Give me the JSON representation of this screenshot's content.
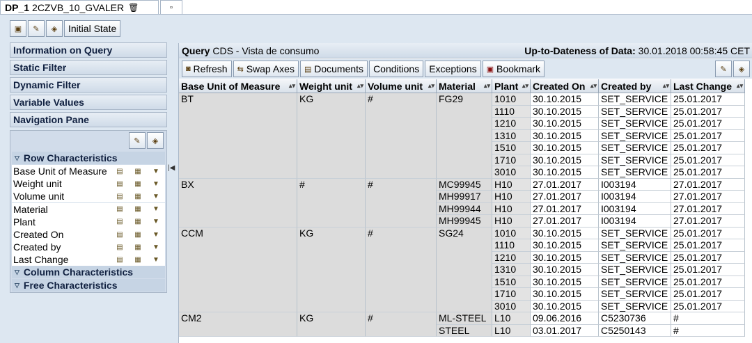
{
  "tab": {
    "id": "DP_1",
    "name": "2CZVB_10_GVALER",
    "delete_icon": "trash-icon",
    "new_icon": "new-page-icon"
  },
  "toolbar": {
    "initial_state": "Initial State",
    "icons": [
      "export-icon",
      "settings-icon",
      "bookmark-icon"
    ]
  },
  "left": {
    "headers": [
      "Information on Query",
      "Static Filter",
      "Dynamic Filter",
      "Variable Values",
      "Navigation Pane"
    ],
    "row_section": "Row Characteristics",
    "row_items": [
      "Base Unit of Measure",
      "Weight unit",
      "Volume unit",
      "Material",
      "Plant",
      "Created On",
      "Created by",
      "Last Change"
    ],
    "column_section": "Column Characteristics",
    "free_section": "Free Characteristics"
  },
  "query": {
    "label": "Query",
    "name": "CDS - Vista de consumo",
    "date_label": "Up-to-Dateness of Data:",
    "date_value": "30.01.2018 00:58:45 CET"
  },
  "rtoolbar": {
    "refresh": "Refresh",
    "swap": "Swap Axes",
    "documents": "Documents",
    "conditions": "Conditions",
    "exceptions": "Exceptions",
    "bookmark": "Bookmark"
  },
  "table": {
    "columns": [
      "Base Unit of Measure",
      "Weight unit",
      "Volume unit",
      "Material",
      "Plant",
      "Created On",
      "Created by",
      "Last Change"
    ],
    "groups": [
      {
        "uom": "BT",
        "weight": "KG",
        "volume": "#",
        "rows": [
          {
            "material": "FG29",
            "plant": "1010",
            "created_on": "30.10.2015",
            "created_by": "SET_SERVICE",
            "last_change": "25.01.2017"
          },
          {
            "material": "",
            "plant": "1110",
            "created_on": "30.10.2015",
            "created_by": "SET_SERVICE",
            "last_change": "25.01.2017"
          },
          {
            "material": "",
            "plant": "1210",
            "created_on": "30.10.2015",
            "created_by": "SET_SERVICE",
            "last_change": "25.01.2017"
          },
          {
            "material": "",
            "plant": "1310",
            "created_on": "30.10.2015",
            "created_by": "SET_SERVICE",
            "last_change": "25.01.2017"
          },
          {
            "material": "",
            "plant": "1510",
            "created_on": "30.10.2015",
            "created_by": "SET_SERVICE",
            "last_change": "25.01.2017"
          },
          {
            "material": "",
            "plant": "1710",
            "created_on": "30.10.2015",
            "created_by": "SET_SERVICE",
            "last_change": "25.01.2017"
          },
          {
            "material": "",
            "plant": "3010",
            "created_on": "30.10.2015",
            "created_by": "SET_SERVICE",
            "last_change": "25.01.2017"
          }
        ]
      },
      {
        "uom": "BX",
        "weight": "#",
        "volume": "#",
        "rows": [
          {
            "material": "MC99945",
            "plant": "H10",
            "created_on": "27.01.2017",
            "created_by": "I003194",
            "last_change": "27.01.2017"
          },
          {
            "material": "MH99917",
            "plant": "H10",
            "created_on": "27.01.2017",
            "created_by": "I003194",
            "last_change": "27.01.2017"
          },
          {
            "material": "MH99944",
            "plant": "H10",
            "created_on": "27.01.2017",
            "created_by": "I003194",
            "last_change": "27.01.2017"
          },
          {
            "material": "MH99945",
            "plant": "H10",
            "created_on": "27.01.2017",
            "created_by": "I003194",
            "last_change": "27.01.2017"
          }
        ]
      },
      {
        "uom": "CCM",
        "weight": "KG",
        "volume": "#",
        "rows": [
          {
            "material": "SG24",
            "plant": "1010",
            "created_on": "30.10.2015",
            "created_by": "SET_SERVICE",
            "last_change": "25.01.2017"
          },
          {
            "material": "",
            "plant": "1110",
            "created_on": "30.10.2015",
            "created_by": "SET_SERVICE",
            "last_change": "25.01.2017"
          },
          {
            "material": "",
            "plant": "1210",
            "created_on": "30.10.2015",
            "created_by": "SET_SERVICE",
            "last_change": "25.01.2017"
          },
          {
            "material": "",
            "plant": "1310",
            "created_on": "30.10.2015",
            "created_by": "SET_SERVICE",
            "last_change": "25.01.2017"
          },
          {
            "material": "",
            "plant": "1510",
            "created_on": "30.10.2015",
            "created_by": "SET_SERVICE",
            "last_change": "25.01.2017"
          },
          {
            "material": "",
            "plant": "1710",
            "created_on": "30.10.2015",
            "created_by": "SET_SERVICE",
            "last_change": "25.01.2017"
          },
          {
            "material": "",
            "plant": "3010",
            "created_on": "30.10.2015",
            "created_by": "SET_SERVICE",
            "last_change": "25.01.2017"
          }
        ]
      },
      {
        "uom": "CM2",
        "weight": "KG",
        "volume": "#",
        "rows": [
          {
            "material": "ML-STEEL",
            "plant": "L10",
            "created_on": "09.06.2016",
            "created_by": "C5230736",
            "last_change": "#"
          },
          {
            "material": "STEEL",
            "plant": "L10",
            "created_on": "03.01.2017",
            "created_by": "C5250143",
            "last_change": "#"
          }
        ]
      }
    ]
  }
}
